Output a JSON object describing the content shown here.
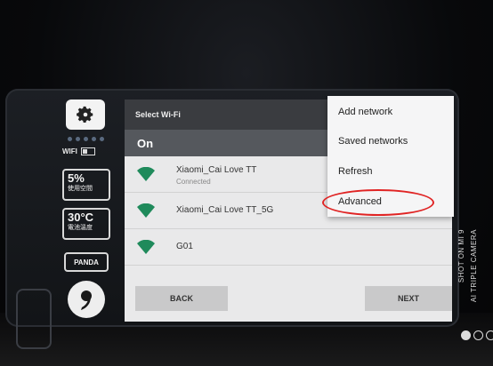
{
  "status_panel": {
    "wifi_label": "WIFI",
    "battery": {
      "value": "5%",
      "label": "使用空間"
    },
    "temperature": {
      "value": "30°C",
      "label": "電池溫度"
    },
    "brand": "PANDA"
  },
  "wifi_screen": {
    "title": "Select Wi-Fi",
    "toggle_state": "On",
    "networks": [
      {
        "name": "Xiaomi_Cai Love TT",
        "status": "Connected"
      },
      {
        "name": "Xiaomi_Cai Love TT_5G",
        "status": ""
      },
      {
        "name": "G01",
        "status": ""
      }
    ],
    "back_label": "BACK",
    "next_label": "NEXT"
  },
  "menu": {
    "items": [
      "Add network",
      "Saved networks",
      "Refresh",
      "Advanced"
    ],
    "highlight_color": "#e02424"
  },
  "watermark": {
    "line1": "SHOT ON MI 9",
    "line2": "AI TRIPLE CAMERA"
  },
  "colors": {
    "wifi_green": "#1f8a5b",
    "title_bar": "#3a3c40",
    "on_bar": "#55585d"
  }
}
